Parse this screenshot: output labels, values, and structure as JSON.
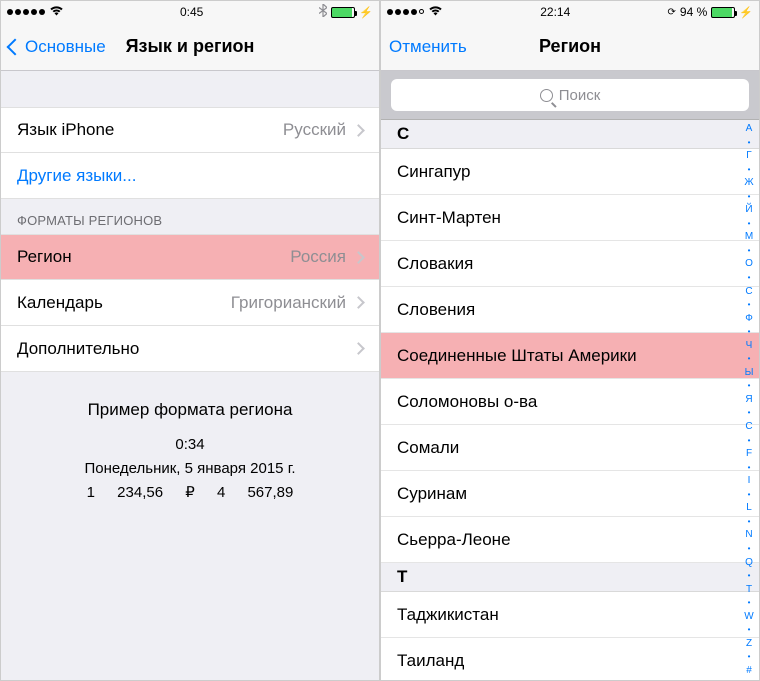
{
  "phone1": {
    "status": {
      "time": "0:45",
      "signal_filled": 5,
      "bluetooth": "✱",
      "battery_pct": ""
    },
    "nav": {
      "back_label": "Основные",
      "title": "Язык и регион"
    },
    "rows": {
      "iphone_lang_label": "Язык iPhone",
      "iphone_lang_value": "Русский",
      "other_langs_label": "Другие языки..."
    },
    "section_header": "ФОРМАТЫ РЕГИОНОВ",
    "region_row": {
      "label": "Регион",
      "value": "Россия"
    },
    "calendar_row": {
      "label": "Календарь",
      "value": "Григорианский"
    },
    "advanced_row": {
      "label": "Дополнительно"
    },
    "example": {
      "title": "Пример формата региона",
      "time": "0:34",
      "date": "Понедельник, 5 января 2015 г.",
      "num1": "1 234,56 ₽",
      "num2": "4 567,89"
    }
  },
  "phone2": {
    "status": {
      "time": "22:14",
      "battery_text": "94 %",
      "signal_filled": 4
    },
    "nav": {
      "cancel_label": "Отменить",
      "title": "Регион"
    },
    "search_placeholder": "Поиск",
    "sections": [
      {
        "letter": "С",
        "items": [
          {
            "name": "Сингапур",
            "highlight": false
          },
          {
            "name": "Синт-Мартен",
            "highlight": false
          },
          {
            "name": "Словакия",
            "highlight": false
          },
          {
            "name": "Словения",
            "highlight": false
          },
          {
            "name": "Соединенные Штаты Америки",
            "highlight": true
          },
          {
            "name": "Соломоновы о-ва",
            "highlight": false
          },
          {
            "name": "Сомали",
            "highlight": false
          },
          {
            "name": "Суринам",
            "highlight": false
          },
          {
            "name": "Сьерра-Леоне",
            "highlight": false
          }
        ]
      },
      {
        "letter": "Т",
        "items": [
          {
            "name": "Таджикистан",
            "highlight": false
          },
          {
            "name": "Таиланд",
            "highlight": false
          }
        ]
      }
    ],
    "index_letters": [
      "А",
      "Г",
      "Ж",
      "Й",
      "М",
      "О",
      "С",
      "Ф",
      "Ч",
      "Ы",
      "Я",
      "C",
      "F",
      "I",
      "L",
      "N",
      "Q",
      "T",
      "W",
      "Z",
      "#"
    ]
  }
}
